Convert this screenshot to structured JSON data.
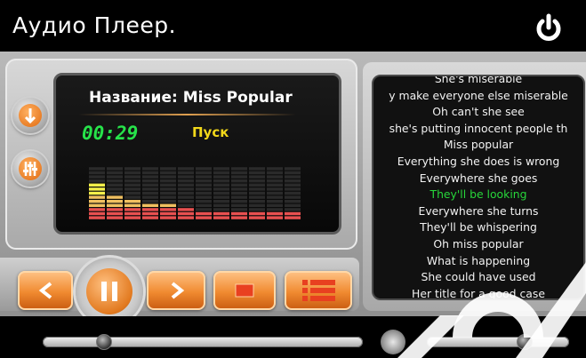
{
  "app": {
    "title": "Аудио Плеер."
  },
  "track": {
    "title": "Название: Miss Popular",
    "time": "00:29",
    "status": "Пуск"
  },
  "equalizer": {
    "levels": [
      9,
      6,
      5,
      4,
      4,
      3,
      2,
      2,
      2,
      2,
      2,
      2
    ],
    "max_level": 13,
    "colors": {
      "top": "#f4f04a",
      "mid": "#f0c060",
      "bottom": "#e85050",
      "empty": "#2a2a2a"
    }
  },
  "lyrics": {
    "lines": [
      "She's miserable",
      "y make everyone else miserable",
      "Oh can't she see",
      "she's putting innocent people th",
      "Miss popular",
      "Everything she does is wrong",
      "Everywhere she goes",
      "They'll be looking",
      "Everywhere she turns",
      "They'll be whispering",
      "Oh miss popular",
      "What is happening",
      "She could have used",
      "Her title for a good case"
    ],
    "current_index": 7
  },
  "playback": {
    "progress": 0.19,
    "volume": 0.68
  },
  "colors": {
    "accent": "#f08a30",
    "time": "#27e34a",
    "status": "#f2d81a",
    "lyric_current": "#27d63a"
  },
  "icons": {
    "power": "power-icon",
    "down": "arrow-down-icon",
    "equalizer": "equalizer-icon",
    "prev": "prev-icon",
    "play_pause": "pause-icon",
    "next": "next-icon",
    "stop": "stop-icon",
    "playlist": "playlist-icon",
    "volume": "volume-icon"
  }
}
